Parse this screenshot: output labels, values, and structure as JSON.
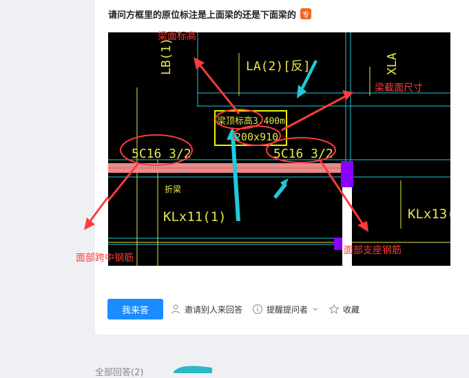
{
  "question": {
    "title": "请问方框里的原位标注是上面梁的还是下面梁的",
    "badge": "专"
  },
  "figure": {
    "cad_labels": {
      "lb": "LB(1)",
      "la": "LA(2)[反]",
      "xla": "XLA",
      "elev_box_top": "梁顶标高3.400m",
      "elev_box_bottom": "200x910",
      "rebar_left": "5C16 3/2",
      "rebar_right": "5C16 3/2",
      "break_mark": "折梁",
      "klx11": "KLx11(1)",
      "klx13": "KLx13("
    },
    "annotations": {
      "beam_elev": "梁面标高",
      "section_size": "梁截面尺寸",
      "midspan_rebar": "面部跨中钢筋",
      "support_rebar": "面部支座钢筋"
    }
  },
  "actions": {
    "answer": "我来答",
    "invite": "邀请别人来回答",
    "remind": "提醒提问者",
    "collect": "收藏"
  },
  "footer": {
    "all_answers": "全部回答(2)"
  },
  "colors": {
    "primary": "#1a8cff",
    "annotation_red": "#ff3b3b",
    "cad_yellow": "#e8e84a",
    "cad_cyan": "#22c8d8"
  }
}
